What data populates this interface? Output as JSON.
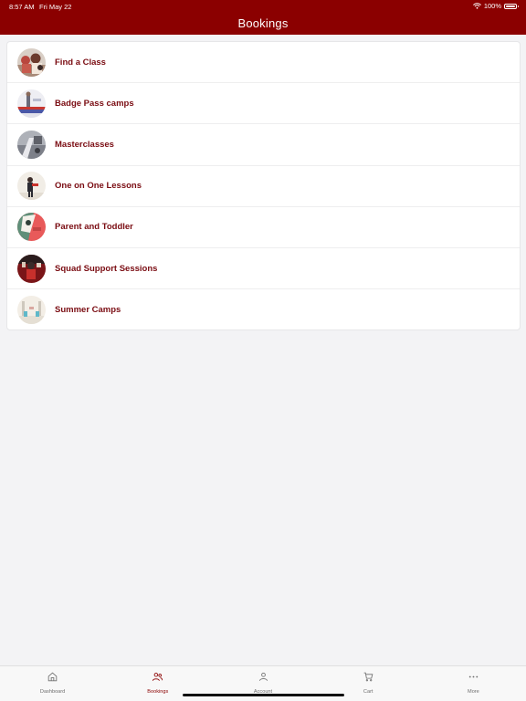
{
  "status_bar": {
    "time": "8:57 AM",
    "date": "Fri May 22",
    "battery": "100%",
    "battery_level": 1.0
  },
  "header": {
    "title": "Bookings"
  },
  "list": {
    "items": [
      {
        "label": "Find a Class",
        "thumb": "find-a-class-photo"
      },
      {
        "label": "Badge Pass camps",
        "thumb": "badge-pass-camps-photo"
      },
      {
        "label": "Masterclasses",
        "thumb": "masterclasses-photo"
      },
      {
        "label": "One on One Lessons",
        "thumb": "one-on-one-photo"
      },
      {
        "label": "Parent and Toddler",
        "thumb": "parent-toddler-photo"
      },
      {
        "label": "Squad Support Sessions",
        "thumb": "squad-support-photo"
      },
      {
        "label": "Summer Camps",
        "thumb": "summer-camps-photo"
      }
    ]
  },
  "tab_bar": {
    "active": "Bookings",
    "tabs": [
      {
        "label": "Dashboard",
        "icon": "home-icon"
      },
      {
        "label": "Bookings",
        "icon": "people-icon"
      },
      {
        "label": "Account",
        "icon": "person-icon"
      },
      {
        "label": "Cart",
        "icon": "cart-icon"
      },
      {
        "label": "More",
        "icon": "more-icon"
      }
    ]
  },
  "colors": {
    "brand": "#8b0000",
    "label": "#7a0c12",
    "background": "#f3f3f5"
  }
}
